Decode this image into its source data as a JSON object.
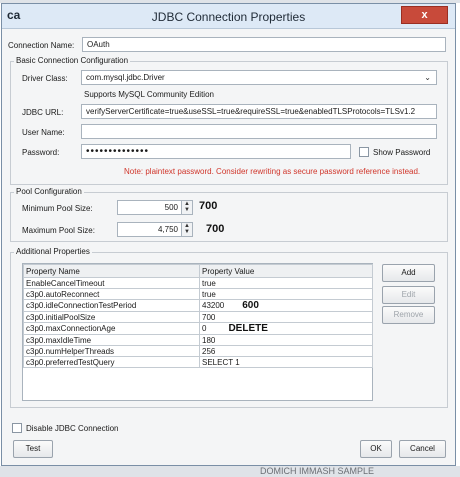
{
  "window": {
    "title": "JDBC Connection Properties",
    "app_icon": "ca",
    "close_label": "x"
  },
  "connection": {
    "label": "Connection Name:",
    "value": "OAuth"
  },
  "basic": {
    "legend": "Basic Connection Configuration",
    "driver_label": "Driver Class:",
    "driver_value": "com.mysql.jdbc.Driver",
    "driver_note": "Supports MySQL Community Edition",
    "url_label": "JDBC URL:",
    "url_value": "verifyServerCertificate=true&useSSL=true&requireSSL=true&enabledTLSProtocols=TLSv1.2",
    "user_label": "User Name:",
    "user_value": "",
    "password_label": "Password:",
    "password_value": "••••••••••••••",
    "show_password": "Show Password",
    "note": "Note: plaintext password. Consider rewriting as secure password reference instead."
  },
  "pool": {
    "legend": "Pool Configuration",
    "min_label": "Minimum Pool Size:",
    "min_value": "500",
    "min_annotation": "700",
    "max_label": "Maximum Pool Size:",
    "max_value": "4,750",
    "max_annotation": "700"
  },
  "additional": {
    "legend": "Additional Properties",
    "col_name": "Property Name",
    "col_value": "Property Value",
    "rows": [
      {
        "name": "EnableCancelTimeout",
        "value": "true",
        "annotation": ""
      },
      {
        "name": "c3p0.autoReconnect",
        "value": "true",
        "annotation": ""
      },
      {
        "name": "c3p0.idleConnectionTestPeriod",
        "value": "43200",
        "annotation": "600"
      },
      {
        "name": "c3p0.initialPoolSize",
        "value": "700",
        "annotation": ""
      },
      {
        "name": "c3p0.maxConnectionAge",
        "value": "0",
        "annotation": "DELETE"
      },
      {
        "name": "c3p0.maxIdleTime",
        "value": "180",
        "annotation": ""
      },
      {
        "name": "c3p0.numHelperThreads",
        "value": "256",
        "annotation": ""
      },
      {
        "name": "c3p0.preferredTestQuery",
        "value": "SELECT 1",
        "annotation": ""
      }
    ],
    "add_label": "Add",
    "edit_label": "Edit",
    "remove_label": "Remove"
  },
  "footer": {
    "disable_label": "Disable JDBC Connection",
    "test_label": "Test",
    "ok_label": "OK",
    "cancel_label": "Cancel"
  },
  "background": {
    "bottom_text": "DOMICH IMMASH SAMPLE"
  }
}
